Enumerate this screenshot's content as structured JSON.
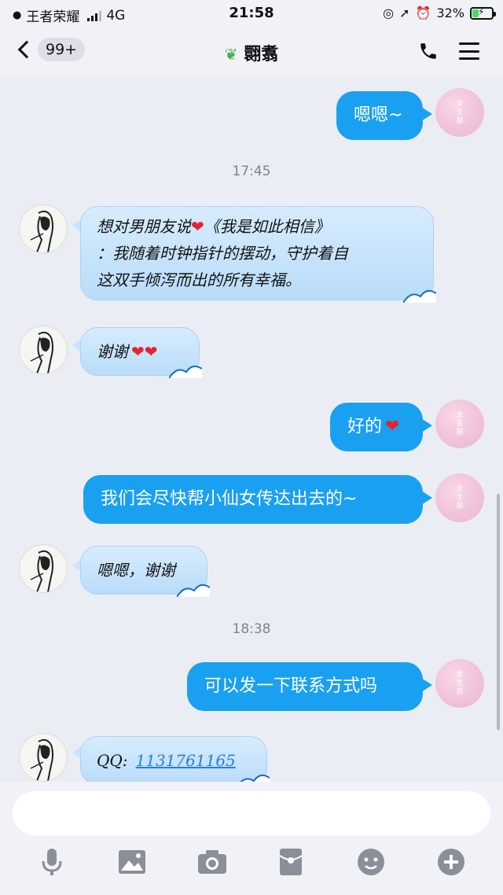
{
  "status_bar": {
    "carrier": "王者荣耀",
    "network": "4G",
    "time": "21:58",
    "battery": "32%",
    "battery_level": 0.32
  },
  "nav": {
    "back_badge": "99+",
    "title": "翾翥"
  },
  "messages": [
    {
      "side": "out",
      "text": "嗯嗯~"
    },
    {
      "type": "time",
      "text": "17:45"
    },
    {
      "side": "in",
      "lines": [
        "想对男朋友说",
        "《我是如此相信》",
        "：我随着时钟指针的摆动，守护着自",
        "这双手倾泻而出的所有幸福。"
      ]
    },
    {
      "side": "in",
      "text": "谢谢"
    },
    {
      "side": "out",
      "text": "好的"
    },
    {
      "side": "out",
      "text": "我们会尽快帮小仙女传达出去的~"
    },
    {
      "side": "in",
      "text": "嗯嗯，谢谢"
    },
    {
      "type": "time",
      "text": "18:38"
    },
    {
      "side": "out",
      "text": "可以发一下联系方式吗"
    },
    {
      "side": "in",
      "label": "QQ:",
      "link": "1131761165"
    }
  ],
  "avatar_text": "女\n生\n部",
  "toolbar": [
    "mic-icon",
    "image-icon",
    "camera-icon",
    "red-packet-icon",
    "emoji-icon",
    "plus-icon"
  ],
  "colors": {
    "outgoing_bubble": "#1aa0f0",
    "incoming_bubble": "#c9e5fb",
    "heart": "#e8232c",
    "background": "#ebedf5"
  }
}
